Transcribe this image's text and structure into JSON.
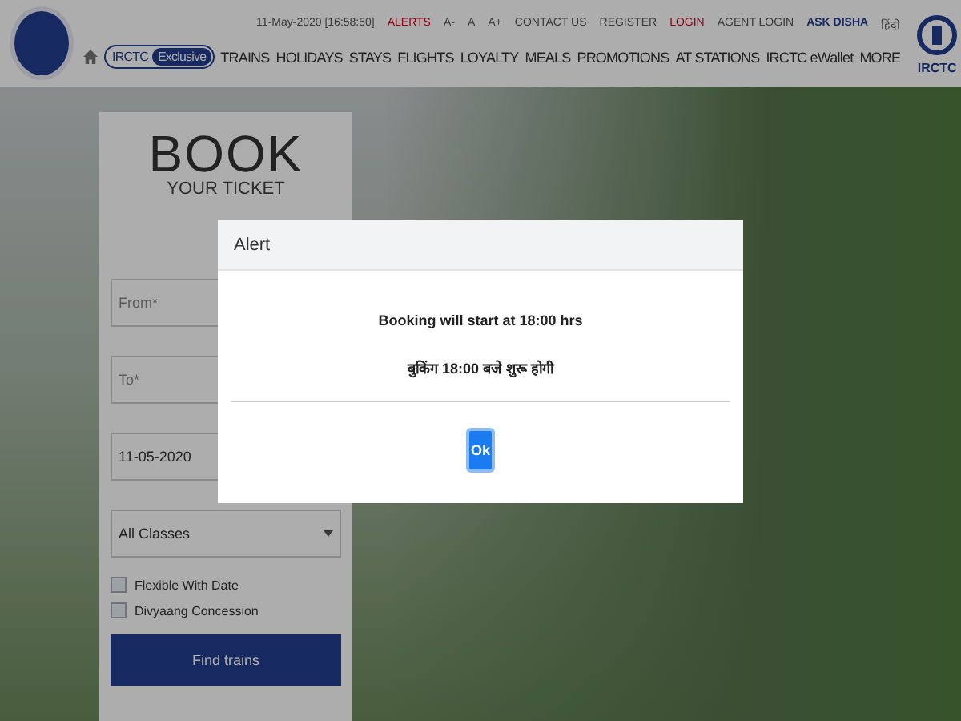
{
  "top_links": [
    {
      "label": "11-May-2020 [16:58:50]",
      "kind": "date"
    },
    {
      "label": "ALERTS",
      "kind": "alert"
    },
    {
      "label": "A-",
      "kind": "plain"
    },
    {
      "label": "A",
      "kind": "plain"
    },
    {
      "label": "A+",
      "kind": "plain"
    },
    {
      "label": "CONTACT US",
      "kind": "plain"
    },
    {
      "label": "REGISTER",
      "kind": "plain"
    },
    {
      "label": "LOGIN",
      "kind": "alert"
    },
    {
      "label": "AGENT LOGIN",
      "kind": "plain"
    },
    {
      "label": "ASK DISHA",
      "kind": "bold"
    },
    {
      "label": "हिंदी",
      "kind": "plain"
    }
  ],
  "badge": {
    "left": "IRCTC",
    "right": "Exclusive"
  },
  "nav": [
    "TRAINS",
    "HOLIDAYS",
    "STAYS",
    "FLIGHTS",
    "LOYALTY",
    "MEALS",
    "PROMOTIONS",
    "AT STATIONS",
    "IRCTC eWallet",
    "MORE"
  ],
  "logo_text": "IRCTC",
  "booking": {
    "title": "BOOK",
    "subtitle": "YOUR TICKET",
    "from_placeholder": "From*",
    "to_placeholder": "To*",
    "date": "11-05-2020",
    "class": "All Classes",
    "options": [
      {
        "label": "Flexible With Date",
        "checked": false
      },
      {
        "label": "Divyaang Concession",
        "checked": false
      }
    ],
    "submit": "Find trains"
  },
  "alert": {
    "title": "Alert",
    "lines": [
      "Booking will start at 18:00 hrs",
      "बुकिंग 18:00 बजे शुरू होगी"
    ],
    "button": "Ok"
  }
}
